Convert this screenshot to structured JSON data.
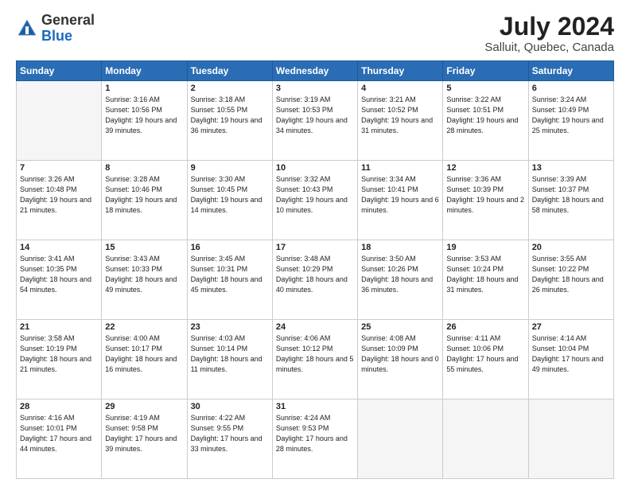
{
  "header": {
    "logo": {
      "general": "General",
      "blue": "Blue"
    },
    "title": "July 2024",
    "subtitle": "Salluit, Quebec, Canada"
  },
  "calendar": {
    "weekdays": [
      "Sunday",
      "Monday",
      "Tuesday",
      "Wednesday",
      "Thursday",
      "Friday",
      "Saturday"
    ],
    "weeks": [
      [
        {
          "day": null
        },
        {
          "day": 1,
          "sunrise": "3:16 AM",
          "sunset": "10:56 PM",
          "daylight": "19 hours and 39 minutes."
        },
        {
          "day": 2,
          "sunrise": "3:18 AM",
          "sunset": "10:55 PM",
          "daylight": "19 hours and 36 minutes."
        },
        {
          "day": 3,
          "sunrise": "3:19 AM",
          "sunset": "10:53 PM",
          "daylight": "19 hours and 34 minutes."
        },
        {
          "day": 4,
          "sunrise": "3:21 AM",
          "sunset": "10:52 PM",
          "daylight": "19 hours and 31 minutes."
        },
        {
          "day": 5,
          "sunrise": "3:22 AM",
          "sunset": "10:51 PM",
          "daylight": "19 hours and 28 minutes."
        },
        {
          "day": 6,
          "sunrise": "3:24 AM",
          "sunset": "10:49 PM",
          "daylight": "19 hours and 25 minutes."
        }
      ],
      [
        {
          "day": 7,
          "sunrise": "3:26 AM",
          "sunset": "10:48 PM",
          "daylight": "19 hours and 21 minutes."
        },
        {
          "day": 8,
          "sunrise": "3:28 AM",
          "sunset": "10:46 PM",
          "daylight": "19 hours and 18 minutes."
        },
        {
          "day": 9,
          "sunrise": "3:30 AM",
          "sunset": "10:45 PM",
          "daylight": "19 hours and 14 minutes."
        },
        {
          "day": 10,
          "sunrise": "3:32 AM",
          "sunset": "10:43 PM",
          "daylight": "19 hours and 10 minutes."
        },
        {
          "day": 11,
          "sunrise": "3:34 AM",
          "sunset": "10:41 PM",
          "daylight": "19 hours and 6 minutes."
        },
        {
          "day": 12,
          "sunrise": "3:36 AM",
          "sunset": "10:39 PM",
          "daylight": "19 hours and 2 minutes."
        },
        {
          "day": 13,
          "sunrise": "3:39 AM",
          "sunset": "10:37 PM",
          "daylight": "18 hours and 58 minutes."
        }
      ],
      [
        {
          "day": 14,
          "sunrise": "3:41 AM",
          "sunset": "10:35 PM",
          "daylight": "18 hours and 54 minutes."
        },
        {
          "day": 15,
          "sunrise": "3:43 AM",
          "sunset": "10:33 PM",
          "daylight": "18 hours and 49 minutes."
        },
        {
          "day": 16,
          "sunrise": "3:45 AM",
          "sunset": "10:31 PM",
          "daylight": "18 hours and 45 minutes."
        },
        {
          "day": 17,
          "sunrise": "3:48 AM",
          "sunset": "10:29 PM",
          "daylight": "18 hours and 40 minutes."
        },
        {
          "day": 18,
          "sunrise": "3:50 AM",
          "sunset": "10:26 PM",
          "daylight": "18 hours and 36 minutes."
        },
        {
          "day": 19,
          "sunrise": "3:53 AM",
          "sunset": "10:24 PM",
          "daylight": "18 hours and 31 minutes."
        },
        {
          "day": 20,
          "sunrise": "3:55 AM",
          "sunset": "10:22 PM",
          "daylight": "18 hours and 26 minutes."
        }
      ],
      [
        {
          "day": 21,
          "sunrise": "3:58 AM",
          "sunset": "10:19 PM",
          "daylight": "18 hours and 21 minutes."
        },
        {
          "day": 22,
          "sunrise": "4:00 AM",
          "sunset": "10:17 PM",
          "daylight": "18 hours and 16 minutes."
        },
        {
          "day": 23,
          "sunrise": "4:03 AM",
          "sunset": "10:14 PM",
          "daylight": "18 hours and 11 minutes."
        },
        {
          "day": 24,
          "sunrise": "4:06 AM",
          "sunset": "10:12 PM",
          "daylight": "18 hours and 5 minutes."
        },
        {
          "day": 25,
          "sunrise": "4:08 AM",
          "sunset": "10:09 PM",
          "daylight": "18 hours and 0 minutes."
        },
        {
          "day": 26,
          "sunrise": "4:11 AM",
          "sunset": "10:06 PM",
          "daylight": "17 hours and 55 minutes."
        },
        {
          "day": 27,
          "sunrise": "4:14 AM",
          "sunset": "10:04 PM",
          "daylight": "17 hours and 49 minutes."
        }
      ],
      [
        {
          "day": 28,
          "sunrise": "4:16 AM",
          "sunset": "10:01 PM",
          "daylight": "17 hours and 44 minutes."
        },
        {
          "day": 29,
          "sunrise": "4:19 AM",
          "sunset": "9:58 PM",
          "daylight": "17 hours and 39 minutes."
        },
        {
          "day": 30,
          "sunrise": "4:22 AM",
          "sunset": "9:55 PM",
          "daylight": "17 hours and 33 minutes."
        },
        {
          "day": 31,
          "sunrise": "4:24 AM",
          "sunset": "9:53 PM",
          "daylight": "17 hours and 28 minutes."
        },
        {
          "day": null
        },
        {
          "day": null
        },
        {
          "day": null
        }
      ]
    ]
  }
}
